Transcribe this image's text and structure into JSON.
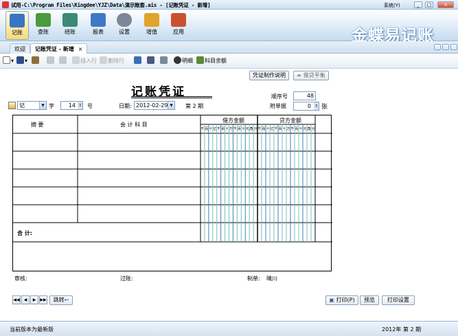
{
  "window": {
    "title": "试用-C:\\Program Files\\Kingdee\\YJZ\\Data\\演示账套.ais - [记账凭证 - 新增]",
    "system_menu": "系统(Y)",
    "btn_min": "_",
    "btn_max": "□",
    "btn_close": "×"
  },
  "ribbon": {
    "buttons": [
      {
        "label": "记账",
        "color": "#3a74c4"
      },
      {
        "label": "查账",
        "color": "#4c9a3e"
      },
      {
        "label": "结账",
        "color": "#3c8a74"
      },
      {
        "label": "报表",
        "color": "#3f78c8"
      },
      {
        "label": "设置",
        "color": "#7a8899"
      },
      {
        "label": "增值",
        "color": "#e0a42a"
      },
      {
        "label": "应用",
        "color": "#c8522e"
      }
    ],
    "logo": "金蝶易记账"
  },
  "tabs": [
    {
      "label": "欢迎"
    },
    {
      "label": "记账凭证 - 新增",
      "close": "×"
    }
  ],
  "toolbar": {
    "insert_row": "插入行",
    "delete_row": "删除行",
    "detail": "明细",
    "balance": "科目余额"
  },
  "top_buttons": {
    "voucher_help": "凭证制作说明",
    "debit_credit_balance": "借贷平衡"
  },
  "voucher": {
    "title": "记账凭证",
    "type_value": "记",
    "zi_label": "字",
    "number_value": "14",
    "number_label": "号",
    "date_label": "日期:",
    "date_value": "2012-02-29",
    "period_label": "第 2 期",
    "seq_label": "顺序号",
    "seq_value": "48",
    "attach_label": "附单据",
    "attach_value": "0",
    "attach_unit": "张"
  },
  "grid": {
    "col_summary": "摘    要",
    "col_account": "会 计 科 目",
    "col_debit": "借方金额",
    "col_credit": "贷方金额",
    "digits": [
      "千",
      "百",
      "十",
      "亿",
      "千",
      "百",
      "十",
      "万",
      "千",
      "百",
      "十",
      "元",
      "角",
      "分"
    ],
    "total_label": "合    计:"
  },
  "signatures": {
    "audit": "审核:",
    "post": "过账:",
    "maker_label": "制单:",
    "maker": "晴川"
  },
  "navigation": {
    "first": "◀◀",
    "prev": "◀",
    "next": "▶",
    "last": "▶▶",
    "jump": "跳转"
  },
  "print": {
    "print": "打印(P)",
    "preview": "预览",
    "settings": "打印设置"
  },
  "status": {
    "left": "当前版本为最新版",
    "right": "2012年 第 2 期"
  }
}
